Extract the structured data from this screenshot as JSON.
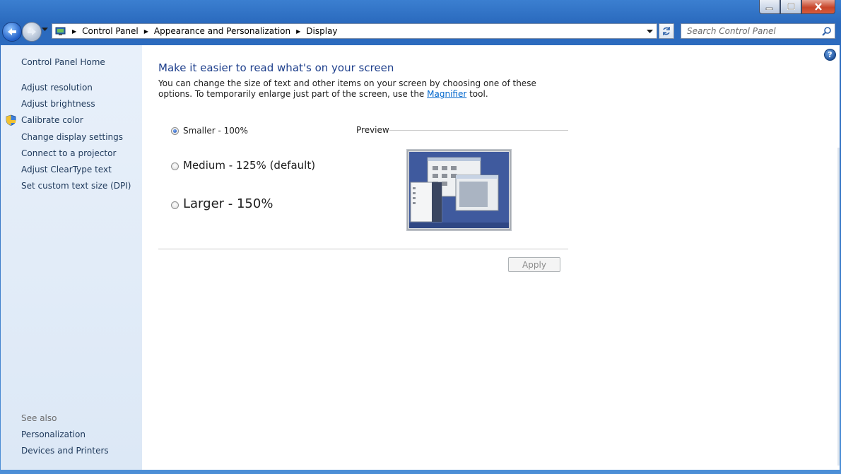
{
  "window": {
    "caption_buttons": [
      "minimize-icon",
      "restore-icon",
      "close-icon"
    ]
  },
  "toolbar": {
    "breadcrumbs": [
      "Control Panel",
      "Appearance and Personalization",
      "Display"
    ],
    "search_placeholder": "Search Control Panel"
  },
  "sidebar": {
    "home": "Control Panel Home",
    "links": [
      "Adjust resolution",
      "Adjust brightness",
      "Calibrate color",
      "Change display settings",
      "Connect to a projector",
      "Adjust ClearType text",
      "Set custom text size (DPI)"
    ],
    "see_also_label": "See also",
    "see_also": [
      "Personalization",
      "Devices and Printers"
    ]
  },
  "main": {
    "title": "Make it easier to read what's on your screen",
    "desc_before": "You can change the size of text and other items on your screen by choosing one of these options. To temporarily enlarge just part of the screen, use the ",
    "desc_link": "Magnifier",
    "desc_after": " tool.",
    "options": [
      {
        "label": "Smaller - 100%",
        "checked": true
      },
      {
        "label": "Medium - 125% (default)",
        "checked": false
      },
      {
        "label": "Larger - 150%",
        "checked": false
      }
    ],
    "preview_label": "Preview",
    "apply_label": "Apply"
  },
  "colors": {
    "link": "#1e395b",
    "title": "#1e3f8c",
    "sidebar_bg": "#dce8f6",
    "window_frame": "#2a69bd"
  }
}
